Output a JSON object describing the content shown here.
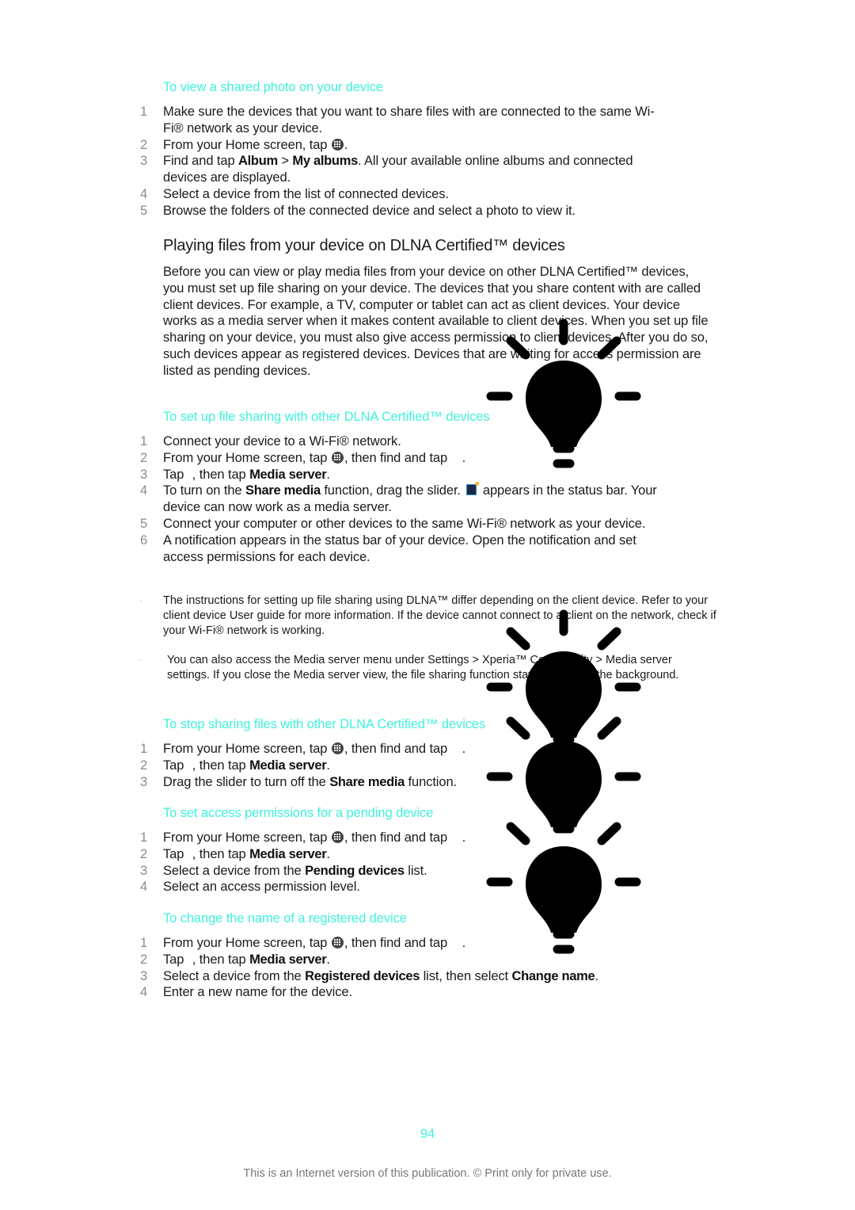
{
  "proc1": {
    "title": "To view a shared photo on your device",
    "steps": [
      {
        "num": "1",
        "parts": [
          "Make sure the devices that you want to share files with are connected to the same Wi-Fi® network as your device."
        ]
      },
      {
        "num": "2",
        "pre": "From your Home screen, tap ",
        "post": "."
      },
      {
        "num": "3",
        "pre": "Find and tap ",
        "b1": "Album",
        "mid": " > ",
        "b2": "My albums",
        "post": ". All your available online albums and connected devices are displayed."
      },
      {
        "num": "4",
        "text": "Select a device from the list of connected devices."
      },
      {
        "num": "5",
        "text": "Browse the folders of the connected device and select a photo to view it."
      }
    ]
  },
  "section": {
    "title": "Playing files from your device on DLNA Certified™ devices",
    "body": "Before you can view or play media files from your device on other DLNA Certified™ devices, you must set up file sharing on your device. The devices that you share content with are called client devices. For example, a TV, computer or tablet can act as client devices. Your device works as a media server when it makes content available to client devices. When you set up file sharing on your device, you must also give access permission to client devices. After you do so, such devices appear as registered devices. Devices that are waiting for access permission are listed as pending devices."
  },
  "proc2": {
    "title": "To set up file sharing with other DLNA Certified™ devices",
    "steps": [
      {
        "num": "1",
        "text": "Connect your device to a Wi-Fi® network."
      },
      {
        "num": "2",
        "pre": "From your Home screen, tap ",
        "post": ", then find and tap ",
        "end": "."
      },
      {
        "num": "3",
        "pre": "Tap ",
        "post": ", then tap ",
        "b1": "Media server",
        "end": "."
      },
      {
        "num": "4",
        "pre": "To turn on the ",
        "b1": "Share media",
        "mid": " function, drag the slider. ",
        "post": " appears in the status bar. Your device can now work as a media server."
      },
      {
        "num": "5",
        "text": "Connect your computer or other devices to the same Wi-Fi® network as your device."
      },
      {
        "num": "6",
        "text": "A notification appears in the status bar of your device. Open the notification and set access permissions for each device."
      }
    ]
  },
  "notes": [
    {
      "mark": "·",
      "text": "The instructions for setting up file sharing using DLNA™ differ depending on the client device. Refer to your client device User guide for more information. If the device cannot connect to a client on the network, check if your Wi-Fi® network is working."
    },
    {
      "mark": "·",
      "text": "You can also access the Media server menu under Settings > Xperia™ Connectivity > Media server settings. If you close the Media server view, the file sharing function stays running in the background."
    }
  ],
  "proc3": {
    "title": "To stop sharing files with other DLNA Certified™ devices",
    "steps": [
      {
        "num": "1",
        "pre": "From your Home screen, tap ",
        "post": ", then find and tap ",
        "end": "."
      },
      {
        "num": "2",
        "pre": "Tap ",
        "post": ", then tap ",
        "b1": "Media server",
        "end": "."
      },
      {
        "num": "3",
        "pre": "Drag the slider to turn off the ",
        "b1": "Share media",
        "end": " function."
      }
    ]
  },
  "proc4": {
    "title": "To set access permissions for a pending device",
    "steps": [
      {
        "num": "1",
        "pre": "From your Home screen, tap ",
        "post": ", then find and tap ",
        "end": "."
      },
      {
        "num": "2",
        "pre": "Tap ",
        "post": ", then tap ",
        "b1": "Media server",
        "end": "."
      },
      {
        "num": "3",
        "pre": "Select a device from the ",
        "b1": "Pending devices",
        "end": " list."
      },
      {
        "num": "4",
        "text": "Select an access permission level."
      }
    ]
  },
  "proc5": {
    "title": "To change the name of a registered device",
    "steps": [
      {
        "num": "1",
        "pre": "From your Home screen, tap ",
        "post": ", then find and tap ",
        "end": "."
      },
      {
        "num": "2",
        "pre": "Tap ",
        "post": ", then tap ",
        "b1": "Media server",
        "end": "."
      },
      {
        "num": "3",
        "pre": "Select a device from the ",
        "b1": "Registered devices",
        "mid": " list, then select ",
        "b2": "Change name",
        "end": "."
      },
      {
        "num": "4",
        "text": "Enter a new name for the device."
      }
    ]
  },
  "icons": {
    "apps": "apps-grid-icon",
    "media_server_status": "media-server-status-icon",
    "tip": "lightbulb-tip-icon"
  },
  "page_number": "94",
  "footer": "This is an Internet version of this publication. © Print only for private use.",
  "colors": {
    "heading_accent": "#3ff2dc",
    "body_text": "#1a1a1a",
    "step_number": "#8a8a8a",
    "footer_text": "#777777"
  }
}
